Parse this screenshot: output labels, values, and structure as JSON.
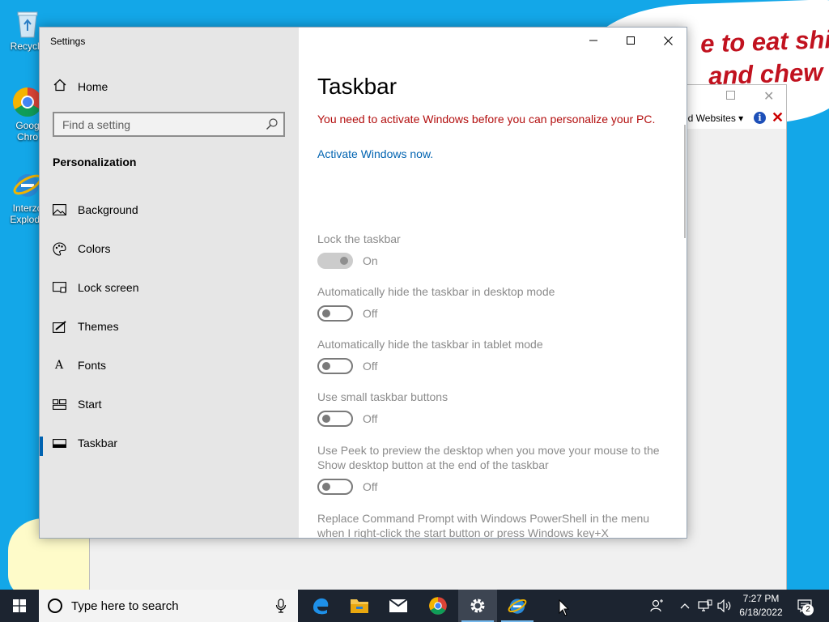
{
  "desktop": {
    "icons": [
      {
        "label": "Recycle",
        "name": "recycle-bin"
      },
      {
        "label": "Goog\nChro",
        "name": "google-chrome"
      },
      {
        "label": "Interzo\nExplode",
        "name": "internet-explorer"
      }
    ],
    "banner_text": "e to eat shit\n and chew"
  },
  "background_window": {
    "sites_label": "ed Websites",
    "info_label": "i",
    "close_label": "✕"
  },
  "settings": {
    "window_title": "Settings",
    "home_label": "Home",
    "search_placeholder": "Find a setting",
    "section_title": "Personalization",
    "nav": [
      {
        "label": "Background",
        "icon": "picture-icon"
      },
      {
        "label": "Colors",
        "icon": "palette-icon"
      },
      {
        "label": "Lock screen",
        "icon": "lock-screen-icon"
      },
      {
        "label": "Themes",
        "icon": "brush-icon"
      },
      {
        "label": "Fonts",
        "icon": "fonts-icon"
      },
      {
        "label": "Start",
        "icon": "start-icon"
      },
      {
        "label": "Taskbar",
        "icon": "taskbar-icon",
        "active": true
      }
    ],
    "page_title": "Taskbar",
    "warning": "You need to activate Windows before you can personalize your PC.",
    "activate_link": "Activate Windows now.",
    "settings": [
      {
        "label": "Lock the taskbar",
        "state": "On",
        "on": true
      },
      {
        "label": "Automatically hide the taskbar in desktop mode",
        "state": "Off",
        "on": false
      },
      {
        "label": "Automatically hide the taskbar in tablet mode",
        "state": "Off",
        "on": false
      },
      {
        "label": "Use small taskbar buttons",
        "state": "Off",
        "on": false
      },
      {
        "label": "Use Peek to preview the desktop when you move your mouse to the Show desktop button at the end of the taskbar",
        "state": "Off",
        "on": false
      },
      {
        "label": "Replace Command Prompt with Windows PowerShell in the menu when I right-click the start button or press Windows key+X"
      }
    ]
  },
  "taskbar": {
    "search_placeholder": "Type here to search",
    "apps": [
      "edge-icon",
      "file-explorer-icon",
      "mail-icon",
      "chrome-icon",
      "settings-icon",
      "internet-explorer-icon"
    ],
    "time": "7:27 PM",
    "date": "6/18/2022",
    "notification_count": "2"
  },
  "colors": {
    "accent": "#0063b1",
    "warning": "#b30e0e",
    "desktop": "#13a7e8",
    "taskbar": "#1c2430"
  }
}
